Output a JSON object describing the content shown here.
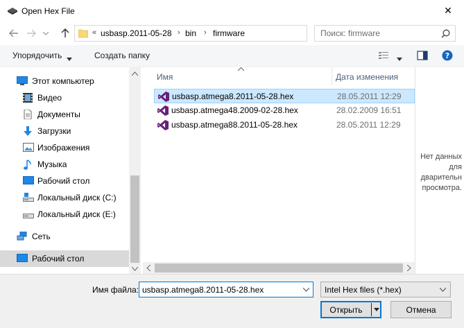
{
  "window": {
    "title": "Open Hex File",
    "close_glyph": "✕"
  },
  "address": {
    "overflow": "«",
    "crumbs": [
      "usbasp.2011-05-28",
      "bin",
      "firmware"
    ],
    "separator": "›"
  },
  "search": {
    "placeholder": "Поиск: firmware"
  },
  "toolbar": {
    "organize_label": "Упорядочить",
    "new_folder_label": "Создать папку"
  },
  "sidebar": {
    "items": [
      {
        "label": "Этот компьютер",
        "icon": "computer-icon"
      },
      {
        "label": "Видео",
        "icon": "video-icon"
      },
      {
        "label": "Документы",
        "icon": "documents-icon"
      },
      {
        "label": "Загрузки",
        "icon": "downloads-icon"
      },
      {
        "label": "Изображения",
        "icon": "images-icon"
      },
      {
        "label": "Музыка",
        "icon": "music-icon"
      },
      {
        "label": "Рабочий стол",
        "icon": "desktop-icon"
      },
      {
        "label": "Локальный диск (C:)",
        "icon": "drive-icon"
      },
      {
        "label": "Локальный диск (E:)",
        "icon": "drive-icon"
      },
      {
        "label": "Сеть",
        "icon": "network-icon"
      },
      {
        "label": "Рабочий стол",
        "icon": "desktop-icon"
      }
    ]
  },
  "file_list": {
    "col_name": "Имя",
    "col_date": "Дата изменения",
    "files": [
      {
        "name": "usbasp.atmega8.2011-05-28.hex",
        "date": "28.05.2011 12:29",
        "selected": true
      },
      {
        "name": "usbasp.atmega48.2009-02-28.hex",
        "date": "28.02.2009 16:51",
        "selected": false
      },
      {
        "name": "usbasp.atmega88.2011-05-28.hex",
        "date": "28.05.2011 12:29",
        "selected": false
      }
    ]
  },
  "preview": {
    "text_lines": [
      "Нет данных",
      "для",
      "дварительн",
      "просмотра."
    ]
  },
  "footer": {
    "filename_label": "Имя файла:",
    "filename_value": "usbasp.atmega8.2011-05-28.hex",
    "filter_value": "Intel Hex files (*.hex)",
    "open_label": "Открыть",
    "cancel_label": "Отмена"
  },
  "colors": {
    "accent": "#0078d7",
    "selection": "#cce8ff",
    "vs_purple": "#68217a",
    "folder_yellow": "#f8d775"
  }
}
